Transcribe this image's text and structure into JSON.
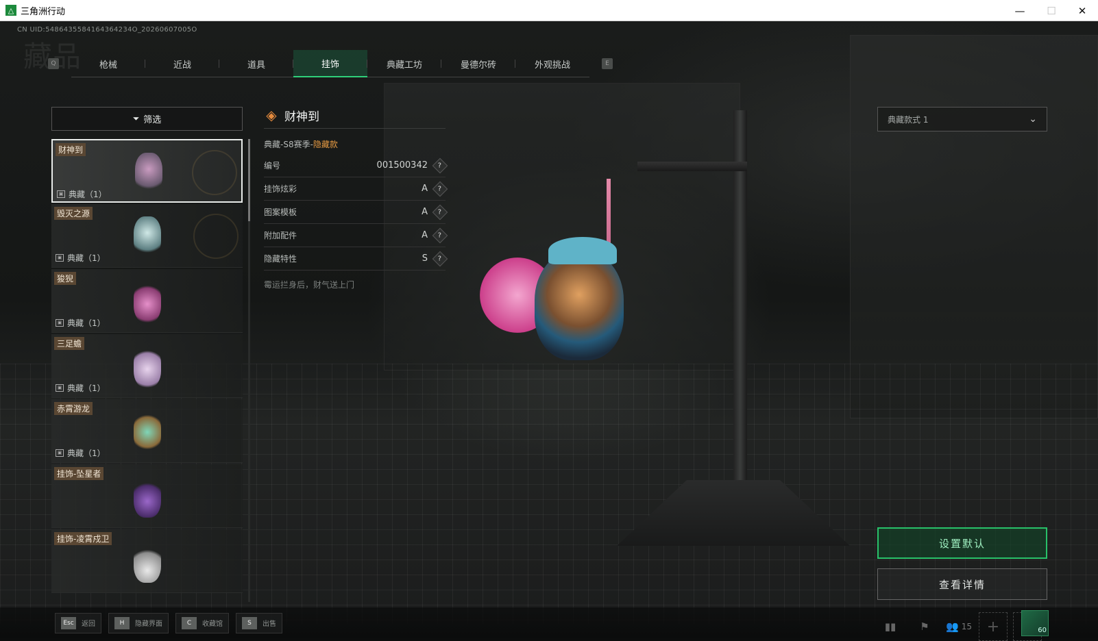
{
  "window": {
    "title": "三角洲行动",
    "min": "—",
    "max": "☐",
    "close": "✕"
  },
  "uid": "CN UID:5486435584164364234O_20260607005O",
  "ghost_title": "藏品",
  "tabs": {
    "left_key": "Q",
    "right_key": "E",
    "items": [
      {
        "label": "枪械"
      },
      {
        "label": "近战"
      },
      {
        "label": "道具"
      },
      {
        "label": "挂饰"
      },
      {
        "label": "典藏工坊"
      },
      {
        "label": "曼德尔砖"
      },
      {
        "label": "外观挑战"
      }
    ],
    "active": "挂饰"
  },
  "filter": {
    "label": "筛选"
  },
  "list": [
    {
      "name": "财神到",
      "tag": "典藏（1）"
    },
    {
      "name": "毁灭之源",
      "tag": "典藏（1）"
    },
    {
      "name": "狻猊",
      "tag": "典藏（1）"
    },
    {
      "name": "三足蟾",
      "tag": "典藏（1）"
    },
    {
      "name": "赤霄游龙",
      "tag": "典藏（1）"
    },
    {
      "name": "挂饰-坠星者",
      "tag": ""
    },
    {
      "name": "挂饰-凌霄戍卫",
      "tag": ""
    }
  ],
  "detail": {
    "title": "财神到",
    "sub_prefix": "典藏-S8赛季-",
    "sub_hidden": "隐藏款",
    "stats": [
      {
        "label": "编号",
        "value": "001500342"
      },
      {
        "label": "挂饰炫彩",
        "value": "A"
      },
      {
        "label": "图案模板",
        "value": "A"
      },
      {
        "label": "附加配件",
        "value": "A"
      },
      {
        "label": "隐藏特性",
        "value": "S"
      }
    ],
    "question_mark": "?",
    "description": "霉运拦身后，财气送上门"
  },
  "variant_select": {
    "value": "典藏款式 1"
  },
  "buttons": {
    "set_default": "设置默认",
    "view_details": "查看详情"
  },
  "bottom_hints": [
    {
      "key": "Esc",
      "label": "返回"
    },
    {
      "key": "H",
      "label": "隐藏界面"
    },
    {
      "key": "C",
      "label": "收藏馆"
    },
    {
      "key": "S",
      "label": "出售"
    }
  ],
  "sys": {
    "friends_count": "15",
    "level": "60"
  },
  "colors": {
    "accent_green": "#28c26a",
    "hidden_orange": "#e69a43",
    "tag_brown": "#5a4733"
  }
}
